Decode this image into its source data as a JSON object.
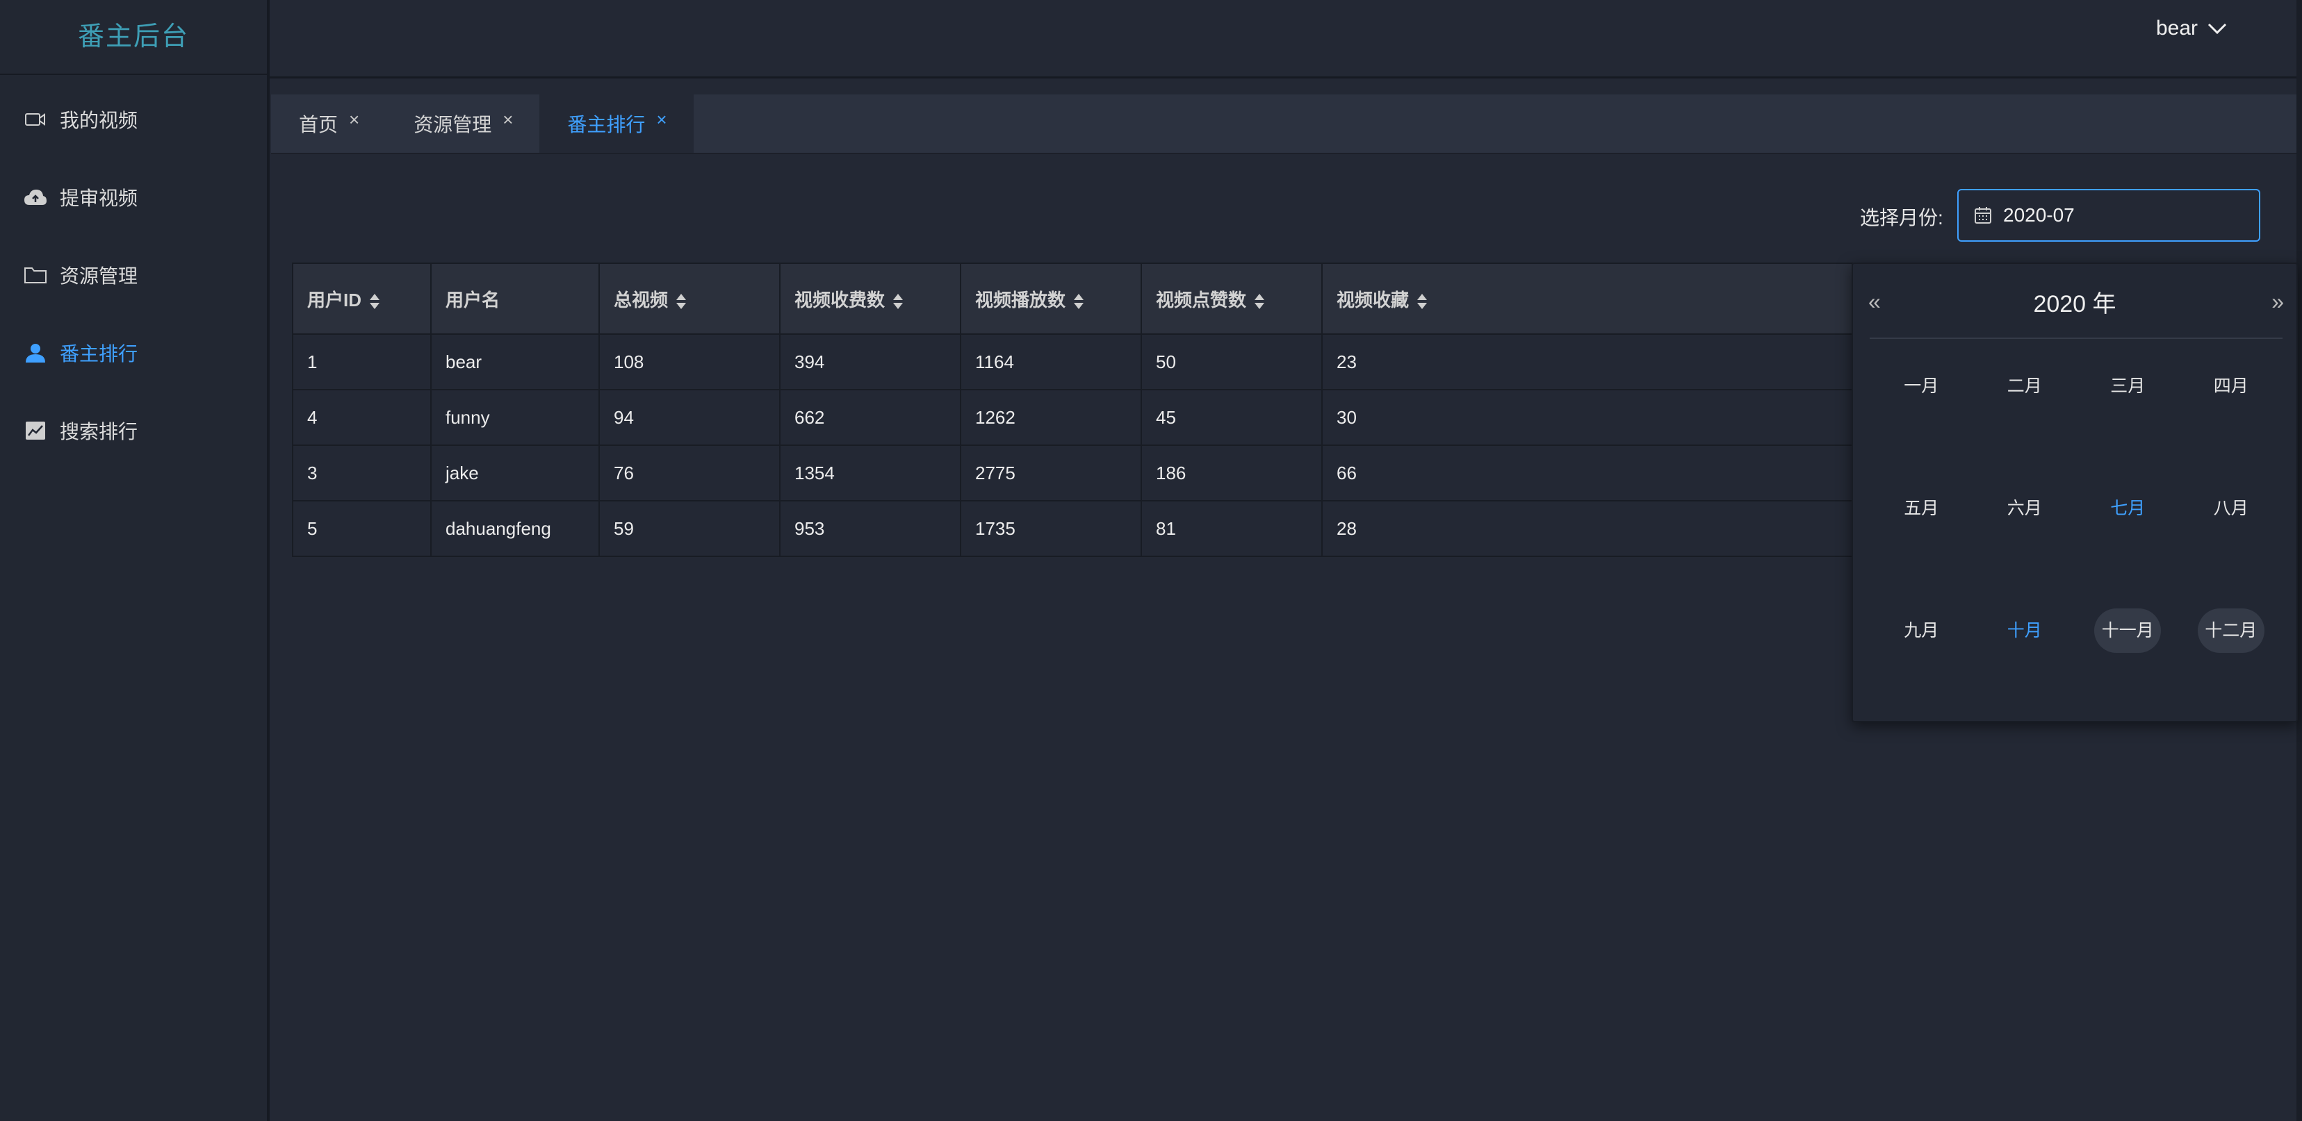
{
  "app": {
    "logo": "番主后台"
  },
  "sidebar": {
    "items": [
      {
        "label": "我的视频",
        "icon": "video-camera-icon"
      },
      {
        "label": "提审视频",
        "icon": "cloud-upload-icon"
      },
      {
        "label": "资源管理",
        "icon": "folder-icon"
      },
      {
        "label": "番主排行",
        "icon": "user-icon",
        "active": true
      },
      {
        "label": "搜索排行",
        "icon": "line-chart-icon"
      }
    ]
  },
  "header": {
    "user": "bear",
    "icon": "chevron-down-icon"
  },
  "tabs": [
    {
      "label": "首页",
      "close": "×"
    },
    {
      "label": "资源管理",
      "close": "×"
    },
    {
      "label": "番主排行",
      "close": "×",
      "active": true
    }
  ],
  "filter": {
    "label": "选择月份:",
    "value": "2020-07",
    "icon": "calendar-icon"
  },
  "table": {
    "columns": [
      "用户ID",
      "用户名",
      "总视频",
      "视频收费数",
      "视频播放数",
      "视频点赞数",
      "视频收藏"
    ],
    "rows": [
      [
        "1",
        "bear",
        "108",
        "394",
        "1164",
        "50",
        "23"
      ],
      [
        "4",
        "funny",
        "94",
        "662",
        "1262",
        "45",
        "30"
      ],
      [
        "3",
        "jake",
        "76",
        "1354",
        "2775",
        "186",
        "66"
      ],
      [
        "5",
        "dahuangfeng",
        "59",
        "953",
        "1735",
        "81",
        "28"
      ]
    ]
  },
  "picker": {
    "prev": "«",
    "next": "»",
    "year": "2020 年",
    "months": [
      "一月",
      "二月",
      "三月",
      "四月",
      "五月",
      "六月",
      "七月",
      "八月",
      "九月",
      "十月",
      "十一月",
      "十二月"
    ],
    "selected": "七月",
    "current": "十月"
  },
  "colors": {
    "accent": "#3fa0ff",
    "logo": "#3e9fb6",
    "background": "#232834"
  }
}
